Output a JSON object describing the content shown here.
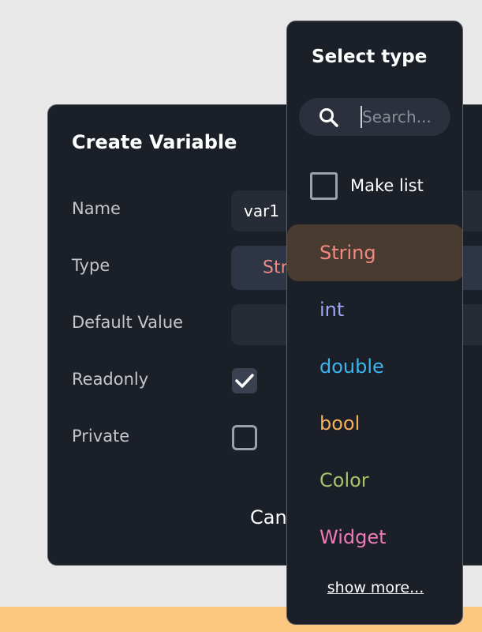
{
  "dialog": {
    "title": "Create Variable",
    "name_label": "Name",
    "name_value": "var1",
    "type_label": "Type",
    "type_value": "String",
    "default_label": "Default Value",
    "default_value": "",
    "readonly_label": "Readonly",
    "readonly_checked": true,
    "private_label": "Private",
    "private_checked": false,
    "cancel_label": "Cancel"
  },
  "popup": {
    "title": "Select type",
    "search_placeholder": "Search...",
    "make_list_label": "Make list",
    "make_list_checked": false,
    "options": [
      {
        "label": "String",
        "color": "#f08a83",
        "selected": true
      },
      {
        "label": "int",
        "color": "#9fa6f2",
        "selected": false
      },
      {
        "label": "double",
        "color": "#3ab5f0",
        "selected": false
      },
      {
        "label": "bool",
        "color": "#f5b05c",
        "selected": false
      },
      {
        "label": "Color",
        "color": "#a8c26b",
        "selected": false
      },
      {
        "label": "Widget",
        "color": "#f07ab8",
        "selected": false
      }
    ],
    "show_more_label": "show more..."
  },
  "colors": {
    "background": "#e8e8e8",
    "panel": "#1b1f27",
    "bottom_strip": "#fcc77e",
    "selected_option": "#4a3b31"
  }
}
